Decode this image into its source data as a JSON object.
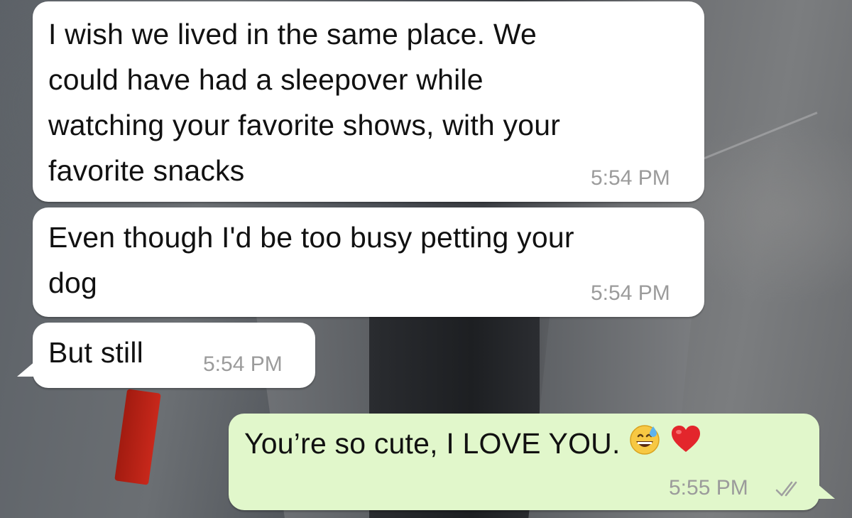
{
  "messages": [
    {
      "direction": "incoming",
      "lines": [
        "I wish we lived in the same place. We",
        "could have had a sleepover while",
        "watching your favorite shows, with your",
        "favorite snacks"
      ],
      "time": "5:54 PM"
    },
    {
      "direction": "incoming",
      "lines": [
        "Even though I'd be too busy petting your",
        "dog"
      ],
      "time": "5:54 PM"
    },
    {
      "direction": "incoming",
      "lines": [
        "But still"
      ],
      "time": "5:54 PM"
    },
    {
      "direction": "outgoing",
      "lines": [
        "You’re so cute, I LOVE YOU."
      ],
      "emojis": [
        "grinning-sweat-emoji",
        "red-heart-emoji"
      ],
      "time": "5:55 PM",
      "status": "read-double-check"
    }
  ],
  "colors": {
    "incoming_bubble": "#ffffff",
    "outgoing_bubble": "#e1f7cb",
    "timestamp": "#9b9b9b",
    "text": "#111111"
  }
}
